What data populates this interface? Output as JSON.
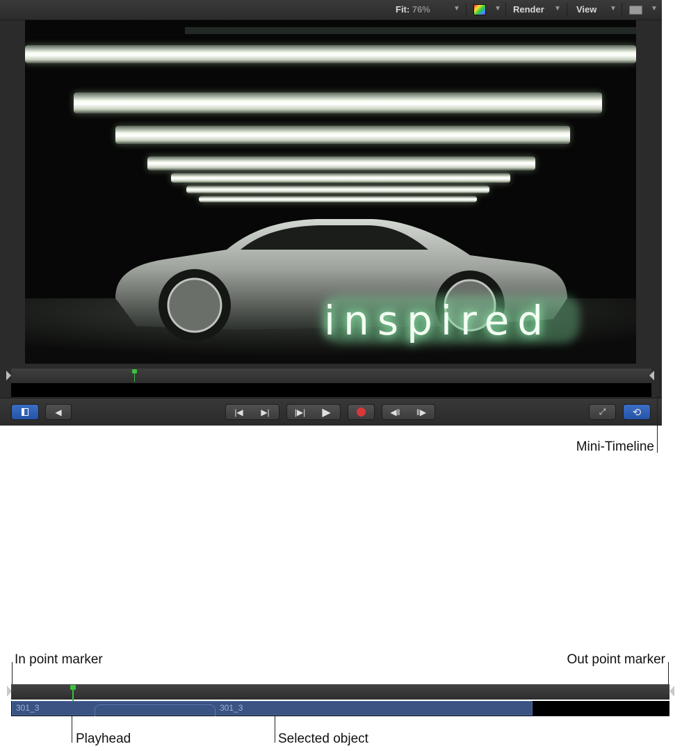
{
  "toolbar": {
    "fit_label": "Fit:",
    "fit_value": "76%",
    "render_label": "Render",
    "view_label": "View"
  },
  "canvas": {
    "overlay_text": "inspired"
  },
  "controls": {
    "buttons": [
      "toggle-canvas",
      "audio",
      "go-to-start",
      "go-to-end",
      "play-from-in",
      "play",
      "record",
      "previous-frame",
      "next-frame",
      "fullscreen",
      "loop"
    ]
  },
  "callouts": {
    "mini_timeline": "Mini-Timeline",
    "in_point_marker": "In point marker",
    "out_point_marker": "Out point marker",
    "playhead": "Playhead",
    "selected_object": "Selected object"
  },
  "zoom_timeline": {
    "clip_label_1": "301_3",
    "clip_label_2": "301_3"
  },
  "colors": {
    "accent_blue": "#2a5db0",
    "playhead_green": "#3fbf3f",
    "clip_blue": "#3a5383",
    "record_red": "#d9383a"
  }
}
